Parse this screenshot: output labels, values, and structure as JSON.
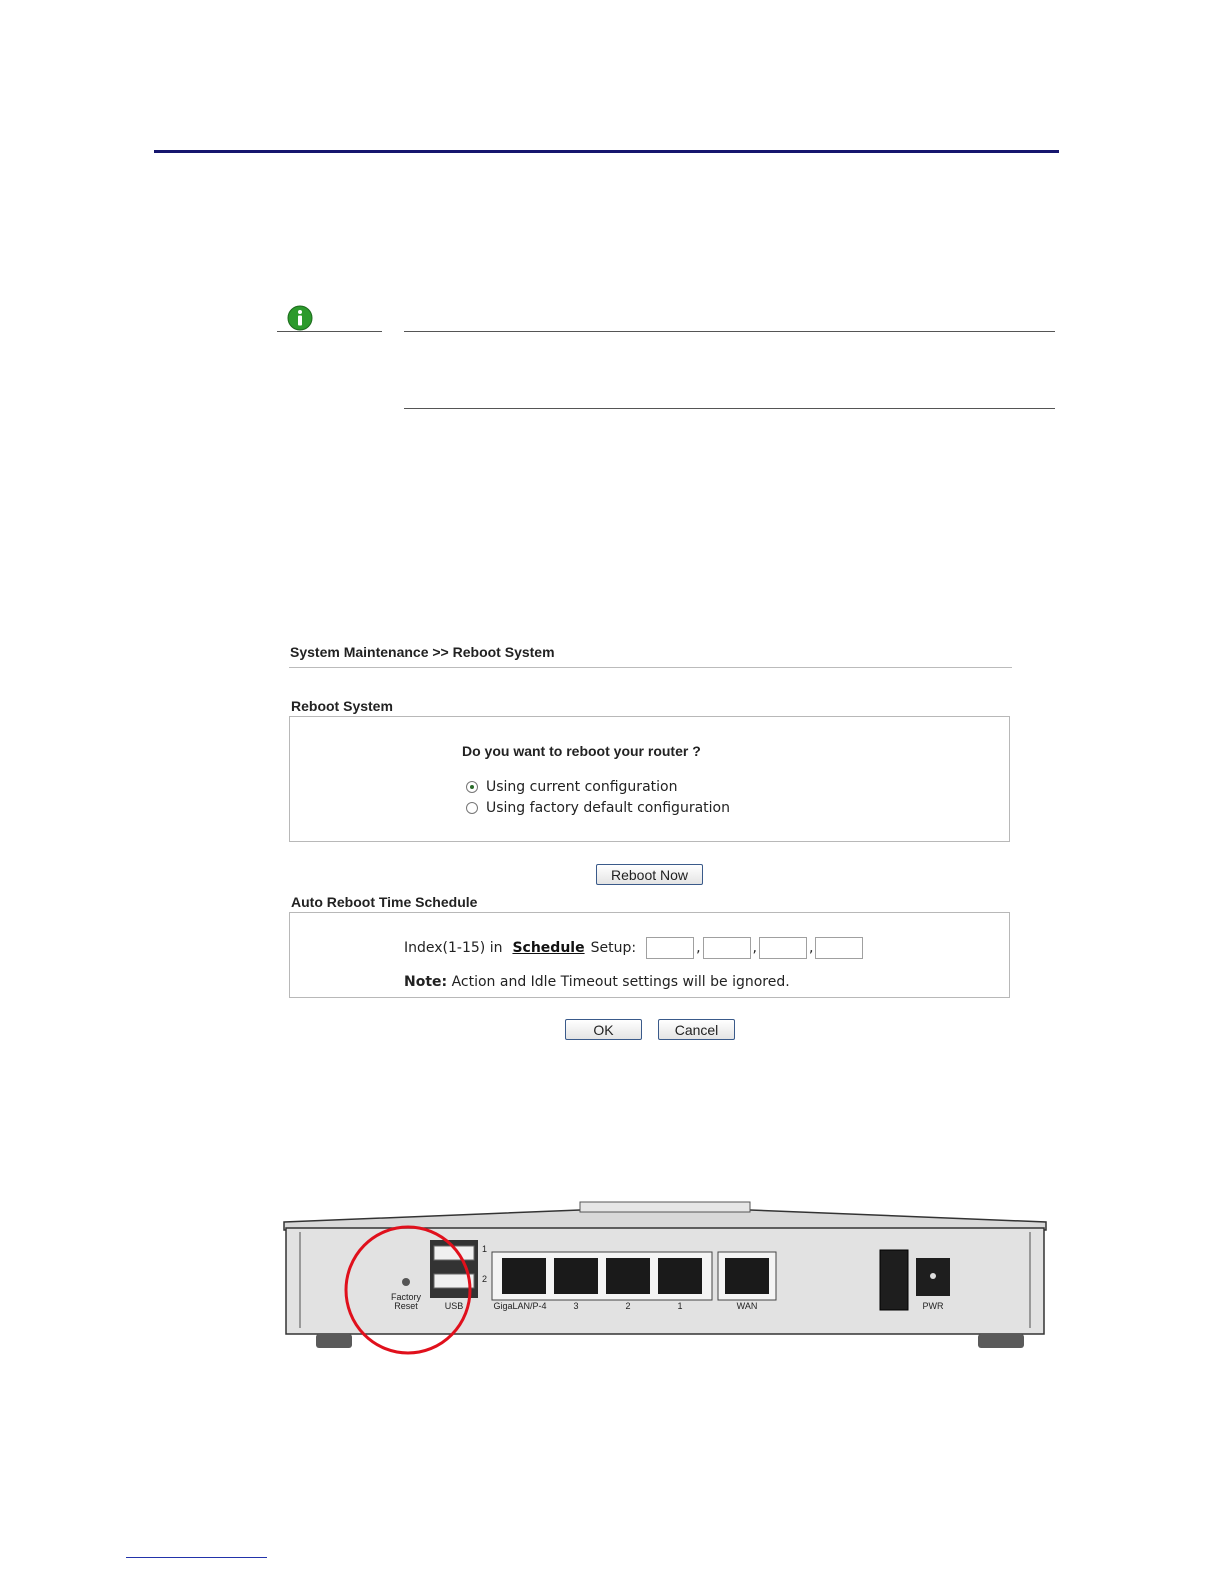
{
  "colors": {
    "header_rule": "#16166e",
    "highlight_circle": "#e0101c",
    "info_icon": "#2c9a2c"
  },
  "web_ui": {
    "breadcrumb": "System Maintenance >> Reboot System",
    "reboot_section": {
      "title": "Reboot System",
      "question": "Do you want to reboot your router ?",
      "options": [
        {
          "label": "Using current configuration",
          "selected": true
        },
        {
          "label": "Using factory default configuration",
          "selected": false
        }
      ],
      "reboot_button": "Reboot Now"
    },
    "schedule_section": {
      "title": "Auto Reboot Time Schedule",
      "index_prefix": "Index(1-15) in",
      "schedule_link": "Schedule",
      "setup_suffix": "Setup:",
      "inputs": [
        "",
        "",
        "",
        ""
      ],
      "note_label": "Note:",
      "note_text": "Action and Idle Timeout settings will be ignored."
    },
    "ok_button": "OK",
    "cancel_button": "Cancel"
  },
  "router_photo": {
    "labels": {
      "factory": "Factory",
      "reset": "Reset",
      "usb": "USB",
      "usb_1": "1",
      "usb_2": "2",
      "lan4": "GigaLAN/P-4",
      "lan3": "3",
      "lan2": "2",
      "lan1": "1",
      "wan": "WAN",
      "pwr": "PWR"
    }
  }
}
